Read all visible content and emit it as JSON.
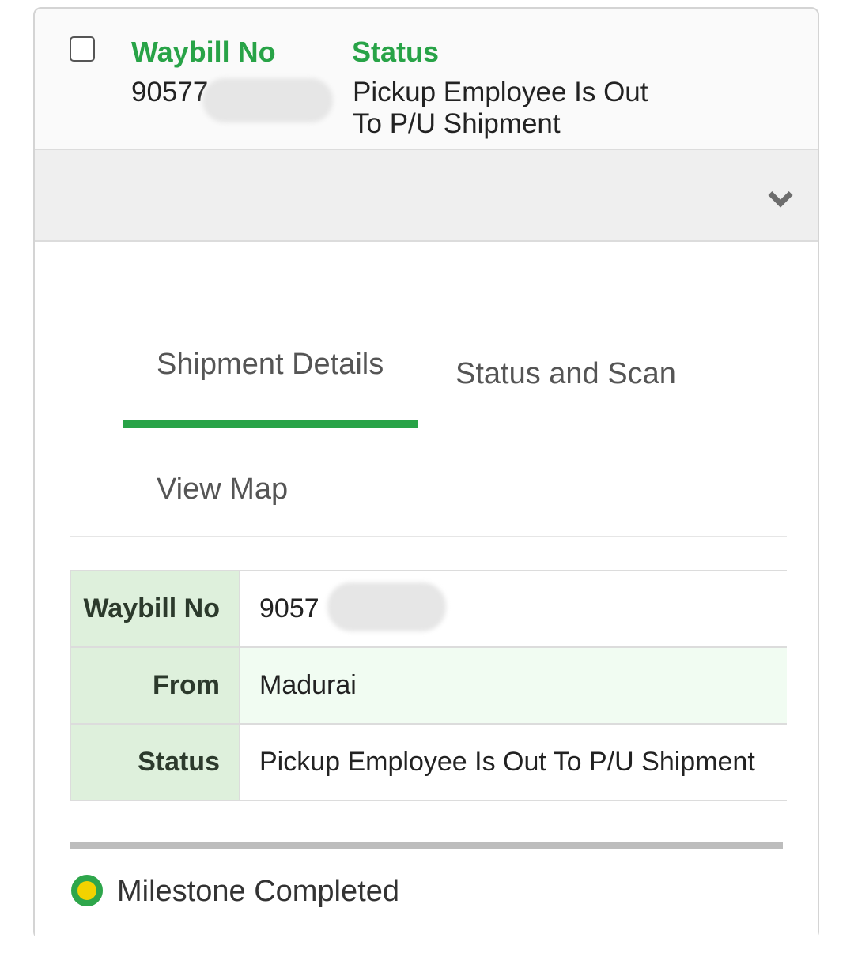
{
  "header": {
    "waybill_label": "Waybill No",
    "waybill_value": "90577",
    "status_label": "Status",
    "status_line1": "Pickup Employee Is Out",
    "status_line2": "To P/U Shipment"
  },
  "tabs": [
    {
      "label": "Shipment Details",
      "active": true
    },
    {
      "label": "Status and Scan",
      "active": false
    },
    {
      "label": "View Map",
      "active": false
    }
  ],
  "details": [
    {
      "key": "Waybill No",
      "value": "9057"
    },
    {
      "key": "From",
      "value": "Madurai"
    },
    {
      "key": "Status",
      "value": "Pickup Employee Is Out To P/U Shipment"
    }
  ],
  "legend": {
    "label": "Milestone Completed"
  },
  "colors": {
    "accent": "#28a347",
    "key_bg": "#def0dc",
    "milestone_ring": "#2ea64b",
    "milestone_dot": "#f2d200"
  }
}
